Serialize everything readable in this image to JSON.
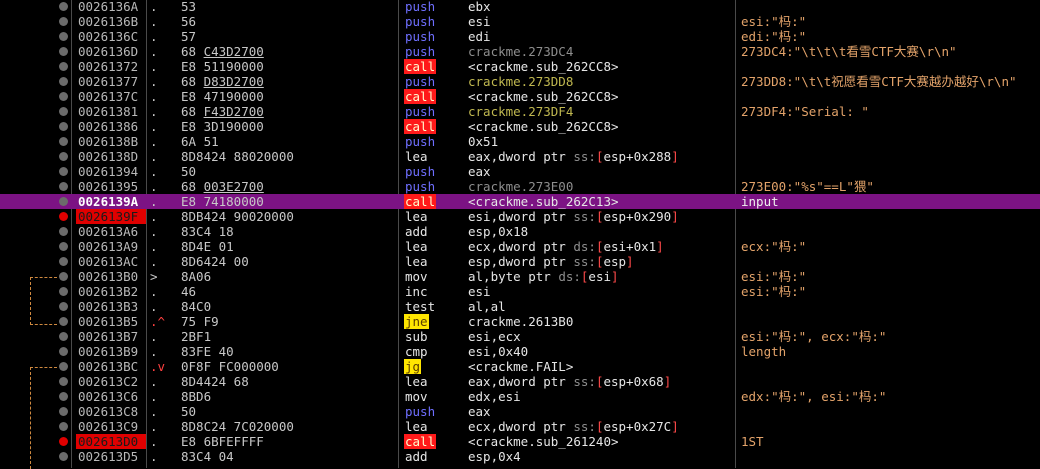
{
  "rows": [
    {
      "addr": "0026136A",
      "mark": ".",
      "hex": "53",
      "mnem": "push",
      "ops": "ebx",
      "comment": ""
    },
    {
      "addr": "0026136B",
      "mark": ".",
      "hex": "56",
      "mnem": "push",
      "ops": "esi",
      "comment": "esi:\"杩:\""
    },
    {
      "addr": "0026136C",
      "mark": ".",
      "hex": "57",
      "mnem": "push",
      "ops": "edi",
      "comment": "edi:\"杩:\""
    },
    {
      "addr": "0026136D",
      "mark": ".",
      "hex": "68 C43D2700",
      "mnem": "push",
      "ops": "crackme.273DC4",
      "comment": "273DC4:\"\\t\\t\\t看雪CTF大赛\\r\\n\""
    },
    {
      "addr": "00261372",
      "mark": ".",
      "hex": "E8 51190000",
      "mnem": "call",
      "ops": "<crackme.sub_262CC8>",
      "comment": ""
    },
    {
      "addr": "00261377",
      "mark": ".",
      "hex": "68 D83D2700",
      "mnem": "push",
      "ops": "crackme.273DD8",
      "comment": "273DD8:\"\\t\\t祝愿看雪CTF大赛越办越好\\r\\n\""
    },
    {
      "addr": "0026137C",
      "mark": ".",
      "hex": "E8 47190000",
      "mnem": "call",
      "ops": "<crackme.sub_262CC8>",
      "comment": ""
    },
    {
      "addr": "00261381",
      "mark": ".",
      "hex": "68 F43D2700",
      "mnem": "push",
      "ops": "crackme.273DF4",
      "comment": "273DF4:\"Serial: \""
    },
    {
      "addr": "00261386",
      "mark": ".",
      "hex": "E8 3D190000",
      "mnem": "call",
      "ops": "<crackme.sub_262CC8>",
      "comment": ""
    },
    {
      "addr": "0026138B",
      "mark": ".",
      "hex": "6A 51",
      "mnem": "push",
      "ops": "0x51",
      "comment": ""
    },
    {
      "addr": "0026138D",
      "mark": ".",
      "hex": "8D8424 88020000",
      "mnem": "lea",
      "ops": "eax,dword ptr ss:[esp+0x288]",
      "comment": ""
    },
    {
      "addr": "00261394",
      "mark": ".",
      "hex": "50",
      "mnem": "push",
      "ops": "eax",
      "comment": ""
    },
    {
      "addr": "00261395",
      "mark": ".",
      "hex": "68 003E2700",
      "mnem": "push",
      "ops": "crackme.273E00",
      "comment": "273E00:\"%s\"==L\"猥\""
    },
    {
      "addr": "0026139A",
      "mark": ".",
      "hex": "E8 74180000",
      "mnem": "call",
      "ops": "<crackme.sub_262C13>",
      "comment": "input"
    },
    {
      "addr": "0026139F",
      "mark": ".",
      "hex": "8DB424 90020000",
      "mnem": "lea",
      "ops": "esi,dword ptr ss:[esp+0x290]",
      "comment": ""
    },
    {
      "addr": "002613A6",
      "mark": ".",
      "hex": "83C4 18",
      "mnem": "add",
      "ops": "esp,0x18",
      "comment": ""
    },
    {
      "addr": "002613A9",
      "mark": ".",
      "hex": "8D4E 01",
      "mnem": "lea",
      "ops": "ecx,dword ptr ds:[esi+0x1]",
      "comment": "ecx:\"杩:\""
    },
    {
      "addr": "002613AC",
      "mark": ".",
      "hex": "8D6424 00",
      "mnem": "lea",
      "ops": "esp,dword ptr ss:[esp]",
      "comment": ""
    },
    {
      "addr": "002613B0",
      "mark": ">",
      "hex": "8A06",
      "mnem": "mov",
      "ops": "al,byte ptr ds:[esi]",
      "comment": "esi:\"杩:\""
    },
    {
      "addr": "002613B2",
      "mark": ".",
      "hex": "46",
      "mnem": "inc",
      "ops": "esi",
      "comment": "esi:\"杩:\""
    },
    {
      "addr": "002613B3",
      "mark": ".",
      "hex": "84C0",
      "mnem": "test",
      "ops": "al,al",
      "comment": ""
    },
    {
      "addr": "002613B5",
      "mark": ".^",
      "hex": "75 F9",
      "mnem": "jne",
      "ops": "crackme.2613B0",
      "comment": ""
    },
    {
      "addr": "002613B7",
      "mark": ".",
      "hex": "2BF1",
      "mnem": "sub",
      "ops": "esi,ecx",
      "comment": "esi:\"杩:\", ecx:\"杩:\""
    },
    {
      "addr": "002613B9",
      "mark": ".",
      "hex": "83FE 40",
      "mnem": "cmp",
      "ops": "esi,0x40",
      "comment": "length"
    },
    {
      "addr": "002613BC",
      "mark": ".v",
      "hex": "0F8F FC000000",
      "mnem": "jg",
      "ops": "<crackme.FAIL>",
      "comment": ""
    },
    {
      "addr": "002613C2",
      "mark": ".",
      "hex": "8D4424 68",
      "mnem": "lea",
      "ops": "eax,dword ptr ss:[esp+0x68]",
      "comment": ""
    },
    {
      "addr": "002613C6",
      "mark": ".",
      "hex": "8BD6",
      "mnem": "mov",
      "ops": "edx,esi",
      "comment": "edx:\"杩:\", esi:\"杩:\""
    },
    {
      "addr": "002613C8",
      "mark": ".",
      "hex": "50",
      "mnem": "push",
      "ops": "eax",
      "comment": ""
    },
    {
      "addr": "002613C9",
      "mark": ".",
      "hex": "8D8C24 7C020000",
      "mnem": "lea",
      "ops": "ecx,dword ptr ss:[esp+0x27C]",
      "comment": ""
    },
    {
      "addr": "002613D0",
      "mark": ".",
      "hex": "E8 6BFEFFFF",
      "mnem": "call",
      "ops": "<crackme.sub_261240>",
      "comment": "1ST"
    },
    {
      "addr": "002613D5",
      "mark": ".",
      "hex": "83C4 04",
      "mnem": "add",
      "ops": "esp,0x4",
      "comment": ""
    }
  ],
  "colors": {
    "selected_row": "#7c1384",
    "breakpoint": "#e00000",
    "call_bg": "#ff1a1a",
    "jcc_bg": "#ffe600",
    "push_text": "#6f6fff",
    "comment_text": "#e3a36a"
  }
}
